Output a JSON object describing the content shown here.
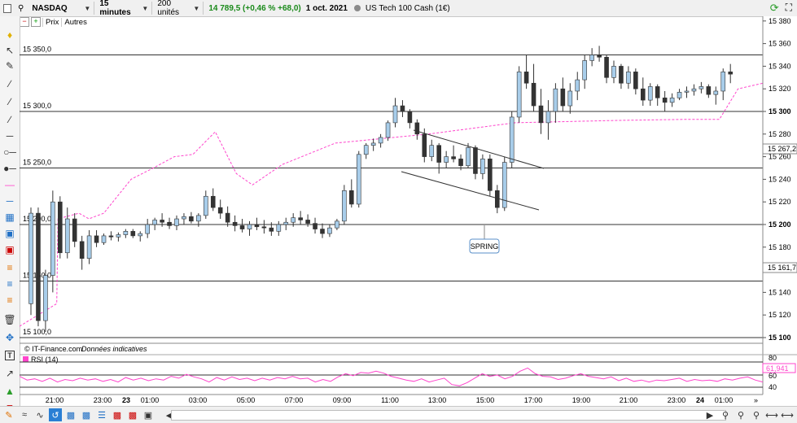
{
  "toolbar": {
    "symbol": "NASDAQ",
    "timeframe": "15 minutes",
    "units": "200 unités",
    "quote": "14 789,5 (+0,46 % +68,0)",
    "date": "1 oct. 2021",
    "instrument": "US Tech 100 Cash (1€)"
  },
  "subbar": {
    "prix": "Prix",
    "autres": "Autres"
  },
  "level_labels": [
    "15 350,0",
    "15 300,0",
    "15 250,0",
    "15 200,0",
    "15 150,0",
    "15 100,0"
  ],
  "right_axis": {
    "ticks": [
      "15 380",
      "15 360",
      "15 340",
      "15 320",
      "15 300",
      "15 280",
      "15 260",
      "15 240",
      "15 220",
      "15 200",
      "15 180",
      "15 160",
      "15 140",
      "15 120",
      "15 100"
    ],
    "bold_ticks": [
      "15 300",
      "15 200",
      "15 100"
    ],
    "price_tag_1": "15 267,2",
    "price_tag_2": "15 161,7"
  },
  "annotation": {
    "spring": "SPRING"
  },
  "credits": {
    "source": "© IT-Finance.com",
    "note": "Données indicatives"
  },
  "rsi": {
    "label": "RSI (14)",
    "value": "61,941",
    "ticks": [
      "80",
      "60",
      "40"
    ]
  },
  "time_axis": [
    "21:00",
    "23:00",
    "23",
    "01:00",
    "03:00",
    "05:00",
    "07:00",
    "09:00",
    "11:00",
    "13:00",
    "15:00",
    "17:00",
    "19:00",
    "21:00",
    "23:00",
    "24",
    "01:00"
  ],
  "colors": {
    "up": "#a8cdea",
    "down": "#333333",
    "ma": "#ff44cc",
    "rsi": "#ff44cc"
  },
  "chart_data": {
    "type": "candlestick",
    "y_range": [
      15090,
      15390
    ],
    "levels": [
      15350,
      15300,
      15250,
      15200,
      15150,
      15100
    ],
    "candles": [
      [
        15130,
        15215,
        15120,
        15210
      ],
      [
        15210,
        15215,
        15110,
        15115
      ],
      [
        15115,
        15160,
        15105,
        15155
      ],
      [
        15155,
        15230,
        15140,
        15220
      ],
      [
        15220,
        15225,
        15170,
        15175
      ],
      [
        15175,
        15215,
        15170,
        15205
      ],
      [
        15205,
        15210,
        15180,
        15185
      ],
      [
        15185,
        15190,
        15160,
        15170
      ],
      [
        15170,
        15195,
        15165,
        15190
      ],
      [
        15190,
        15195,
        15180,
        15184
      ],
      [
        15184,
        15192,
        15182,
        15190
      ],
      [
        15190,
        15194,
        15186,
        15189
      ],
      [
        15189,
        15193,
        15185,
        15191
      ],
      [
        15191,
        15196,
        15188,
        15194
      ],
      [
        15194,
        15196,
        15188,
        15190
      ],
      [
        15190,
        15194,
        15185,
        15192
      ],
      [
        15192,
        15205,
        15188,
        15200
      ],
      [
        15200,
        15206,
        15195,
        15204
      ],
      [
        15204,
        15210,
        15198,
        15202
      ],
      [
        15202,
        15206,
        15196,
        15199
      ],
      [
        15199,
        15208,
        15195,
        15205
      ],
      [
        15205,
        15210,
        15200,
        15207
      ],
      [
        15207,
        15211,
        15201,
        15203
      ],
      [
        15203,
        15210,
        15198,
        15208
      ],
      [
        15208,
        15230,
        15205,
        15225
      ],
      [
        15225,
        15232,
        15212,
        15215
      ],
      [
        15215,
        15222,
        15205,
        15210
      ],
      [
        15210,
        15216,
        15198,
        15202
      ],
      [
        15202,
        15208,
        15194,
        15199
      ],
      [
        15199,
        15205,
        15193,
        15196
      ],
      [
        15196,
        15203,
        15190,
        15200
      ],
      [
        15200,
        15206,
        15195,
        15198
      ],
      [
        15198,
        15204,
        15192,
        15197
      ],
      [
        15197,
        15202,
        15190,
        15194
      ],
      [
        15194,
        15203,
        15190,
        15200
      ],
      [
        15200,
        15206,
        15195,
        15202
      ],
      [
        15202,
        15210,
        15198,
        15206
      ],
      [
        15206,
        15212,
        15200,
        15204
      ],
      [
        15204,
        15209,
        15198,
        15201
      ],
      [
        15201,
        15206,
        15192,
        15196
      ],
      [
        15196,
        15201,
        15188,
        15192
      ],
      [
        15192,
        15200,
        15189,
        15197
      ],
      [
        15197,
        15205,
        15195,
        15203
      ],
      [
        15203,
        15235,
        15200,
        15230
      ],
      [
        15230,
        15240,
        15215,
        15218
      ],
      [
        15218,
        15265,
        15215,
        15262
      ],
      [
        15262,
        15272,
        15258,
        15270
      ],
      [
        15270,
        15276,
        15265,
        15272
      ],
      [
        15272,
        15280,
        15268,
        15277
      ],
      [
        15277,
        15292,
        15274,
        15290
      ],
      [
        15290,
        15312,
        15286,
        15305
      ],
      [
        15305,
        15310,
        15295,
        15300
      ],
      [
        15300,
        15302,
        15285,
        15290
      ],
      [
        15290,
        15293,
        15275,
        15280
      ],
      [
        15280,
        15285,
        15255,
        15260
      ],
      [
        15260,
        15275,
        15256,
        15270
      ],
      [
        15270,
        15272,
        15245,
        15255
      ],
      [
        15255,
        15265,
        15250,
        15260
      ],
      [
        15260,
        15270,
        15255,
        15258
      ],
      [
        15258,
        15262,
        15248,
        15252
      ],
      [
        15252,
        15272,
        15250,
        15268
      ],
      [
        15268,
        15270,
        15240,
        15245
      ],
      [
        15245,
        15262,
        15240,
        15258
      ],
      [
        15258,
        15262,
        15225,
        15230
      ],
      [
        15230,
        15235,
        15210,
        15215
      ],
      [
        15215,
        15260,
        15212,
        15255
      ],
      [
        15255,
        15300,
        15250,
        15295
      ],
      [
        15295,
        15340,
        15290,
        15335
      ],
      [
        15335,
        15350,
        15320,
        15325
      ],
      [
        15325,
        15342,
        15300,
        15305
      ],
      [
        15305,
        15320,
        15280,
        15290
      ],
      [
        15290,
        15310,
        15275,
        15300
      ],
      [
        15300,
        15325,
        15290,
        15320
      ],
      [
        15320,
        15330,
        15300,
        15305
      ],
      [
        15305,
        15325,
        15298,
        15318
      ],
      [
        15318,
        15335,
        15310,
        15328
      ],
      [
        15328,
        15350,
        15320,
        15345
      ],
      [
        15345,
        15356,
        15340,
        15350
      ],
      [
        15350,
        15358,
        15344,
        15348
      ],
      [
        15348,
        15350,
        15325,
        15330
      ],
      [
        15330,
        15345,
        15325,
        15340
      ],
      [
        15340,
        15342,
        15320,
        15325
      ],
      [
        15325,
        15340,
        15320,
        15335
      ],
      [
        15335,
        15338,
        15315,
        15320
      ],
      [
        15320,
        15330,
        15305,
        15310
      ],
      [
        15310,
        15325,
        15305,
        15322
      ],
      [
        15322,
        15324,
        15305,
        15312
      ],
      [
        15312,
        15318,
        15300,
        15308
      ],
      [
        15308,
        15316,
        15304,
        15312
      ],
      [
        15312,
        15320,
        15310,
        15317
      ],
      [
        15317,
        15322,
        15312,
        15318
      ],
      [
        15318,
        15324,
        15314,
        15320
      ],
      [
        15320,
        15326,
        15316,
        15322
      ],
      [
        15322,
        15324,
        15312,
        15315
      ],
      [
        15315,
        15322,
        15306,
        15318
      ],
      [
        15318,
        15338,
        15310,
        15335
      ],
      [
        15335,
        15342,
        15325,
        15333
      ]
    ],
    "ma": [
      [
        0,
        15110
      ],
      [
        30,
        15130
      ],
      [
        31,
        15205
      ],
      [
        48,
        15210
      ],
      [
        56,
        15205
      ],
      [
        68,
        15210
      ],
      [
        90,
        15240
      ],
      [
        108,
        15250
      ],
      [
        125,
        15260
      ],
      [
        140,
        15262
      ],
      [
        158,
        15282
      ],
      [
        175,
        15245
      ],
      [
        188,
        15235
      ],
      [
        212,
        15253
      ],
      [
        255,
        15272
      ],
      [
        330,
        15280
      ],
      [
        400,
        15290
      ],
      [
        480,
        15292
      ],
      [
        539,
        15293
      ],
      [
        565,
        15293
      ],
      [
        580,
        15320
      ],
      [
        600,
        15325
      ]
    ],
    "rsi": [
      58,
      52,
      54,
      50,
      55,
      49,
      53,
      51,
      55,
      52,
      54,
      50,
      53,
      49,
      56,
      52,
      55,
      51,
      54,
      52,
      58,
      55,
      61,
      57,
      54,
      49,
      56,
      52,
      57,
      53,
      55,
      51,
      55,
      52,
      56,
      54,
      58,
      54,
      55,
      49,
      53,
      50,
      57,
      62,
      59,
      64,
      63,
      66,
      63,
      58,
      55,
      52,
      50,
      54,
      49,
      52,
      55,
      45,
      43,
      48,
      55,
      62,
      58,
      60,
      54,
      58,
      66,
      71,
      62,
      58,
      57,
      53,
      55,
      59,
      62,
      58,
      56,
      54,
      57,
      51,
      55,
      50,
      52,
      49,
      52,
      51,
      53,
      55,
      50,
      53,
      51,
      52,
      50,
      54,
      52,
      55,
      57,
      52,
      49
    ]
  }
}
